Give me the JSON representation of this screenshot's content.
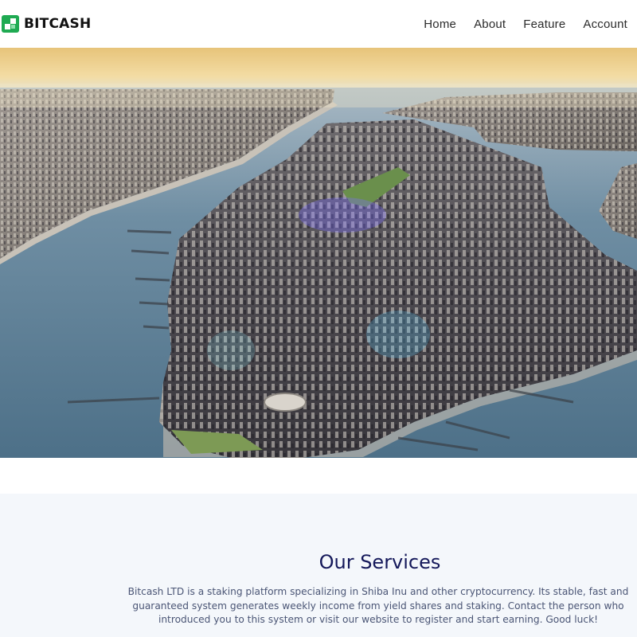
{
  "header": {
    "brand_name": "BITCASH",
    "nav": [
      {
        "label": "Home"
      },
      {
        "label": "About"
      },
      {
        "label": "Feature"
      },
      {
        "label": "Account"
      }
    ]
  },
  "hero": {
    "image": "aerial-city-island-image"
  },
  "services": {
    "title": "Our Services",
    "description": "Bitcash LTD is a staking platform specializing in Shiba Inu and other cryptocurrency. Its stable, fast and guaranteed system generates weekly income from yield shares and staking. Contact the person who introduced you to this system or visit our website to register and start earning. Good luck!"
  },
  "colors": {
    "brand_green": "#1faa52",
    "title_navy": "#14185a",
    "section_bg": "#f4f7fb"
  }
}
